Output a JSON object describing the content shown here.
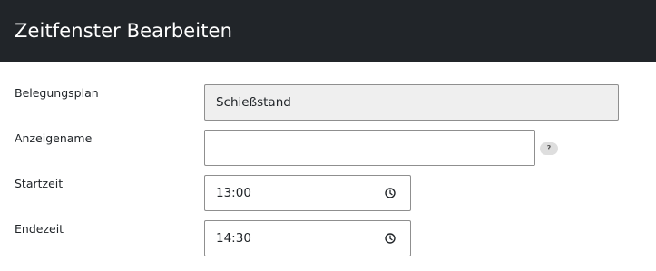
{
  "header": {
    "title": "Zeitfenster Bearbeiten"
  },
  "form": {
    "belegungsplan": {
      "label": "Belegungsplan",
      "value": "Schießstand"
    },
    "anzeigename": {
      "label": "Anzeigename",
      "value": "",
      "help": "?"
    },
    "startzeit": {
      "label": "Startzeit",
      "value": "13:00",
      "icon": "clock-icon"
    },
    "endezeit": {
      "label": "Endezeit",
      "value": "14:30",
      "icon": "clock-icon"
    }
  },
  "colors": {
    "header_bg": "#212529",
    "readonly_bg": "#efefef"
  }
}
